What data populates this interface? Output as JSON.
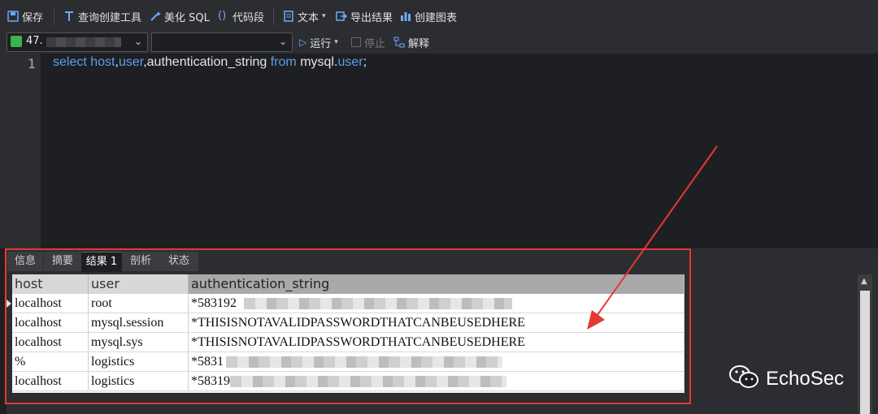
{
  "toolbar": {
    "save": "保存",
    "query_builder": "查询创建工具",
    "beautify_sql": "美化 SQL",
    "snippet": "代码段",
    "text": "文本",
    "export": "导出结果",
    "create_chart": "创建图表"
  },
  "run_bar": {
    "connection": "47.",
    "database": "",
    "run": "运行",
    "stop": "停止",
    "explain": "解释"
  },
  "editor": {
    "line_number": "1",
    "tokens": [
      {
        "t": "select ",
        "k": "kw"
      },
      {
        "t": "host",
        "k": "kw"
      },
      {
        "t": ",",
        "k": "tx"
      },
      {
        "t": "user",
        "k": "kw"
      },
      {
        "t": ",authentication_string ",
        "k": "tx"
      },
      {
        "t": "from ",
        "k": "kw"
      },
      {
        "t": "mysql.",
        "k": "tx"
      },
      {
        "t": "user",
        "k": "kw"
      },
      {
        "t": ";",
        "k": "tx"
      }
    ]
  },
  "result_tabs": [
    "信息",
    "摘要",
    "结果 1",
    "剖析",
    "状态"
  ],
  "result_grid": {
    "columns": [
      "host",
      "user",
      "authentication_string"
    ],
    "rows": [
      [
        "localhost",
        "root",
        "*583192"
      ],
      [
        "localhost",
        "mysql.session",
        "*THISISNOTAVALIDPASSWORDTHATCANBEUSEDHERE"
      ],
      [
        "localhost",
        "mysql.sys",
        "*THISISNOTAVALIDPASSWORDTHATCANBEUSEDHERE"
      ],
      [
        "%",
        "logistics",
        "*5831"
      ],
      [
        "localhost",
        "logistics",
        "*58319"
      ]
    ]
  },
  "watermark": "EchoSec",
  "colors": {
    "keyword": "#5c9cf5",
    "annotation": "#e53935"
  }
}
